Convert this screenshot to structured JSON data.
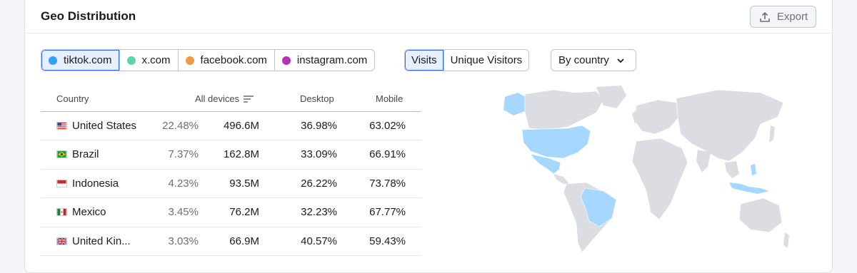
{
  "header": {
    "title": "Geo Distribution",
    "export_label": "Export"
  },
  "domains": [
    {
      "label": "tiktok.com",
      "color": "#2fa3f5",
      "active": true
    },
    {
      "label": "x.com",
      "color": "#5fd3a5",
      "active": false
    },
    {
      "label": "facebook.com",
      "color": "#f29945",
      "active": false
    },
    {
      "label": "instagram.com",
      "color": "#b234b8",
      "active": false
    }
  ],
  "metrics": {
    "visits": "Visits",
    "unique": "Unique Visitors"
  },
  "dropdown": {
    "value": "By country"
  },
  "table": {
    "headers": {
      "country": "Country",
      "all": "All devices",
      "desktop": "Desktop",
      "mobile": "Mobile"
    },
    "rows": [
      {
        "country": "United States",
        "flag": "us",
        "share": "22.48%",
        "all": "496.6M",
        "desktop": "36.98%",
        "mobile": "63.02%"
      },
      {
        "country": "Brazil",
        "flag": "br",
        "share": "7.37%",
        "all": "162.8M",
        "desktop": "33.09%",
        "mobile": "66.91%"
      },
      {
        "country": "Indonesia",
        "flag": "id",
        "share": "4.23%",
        "all": "93.5M",
        "desktop": "26.22%",
        "mobile": "73.78%"
      },
      {
        "country": "Mexico",
        "flag": "mx",
        "share": "3.45%",
        "all": "76.2M",
        "desktop": "32.23%",
        "mobile": "67.77%"
      },
      {
        "country": "United Kin...",
        "flag": "gb",
        "share": "3.03%",
        "all": "66.9M",
        "desktop": "40.57%",
        "mobile": "59.43%"
      }
    ]
  },
  "colors": {
    "highlight": "#a6d8ff",
    "land": "#dcdde2",
    "accent": "#2f6fed"
  }
}
